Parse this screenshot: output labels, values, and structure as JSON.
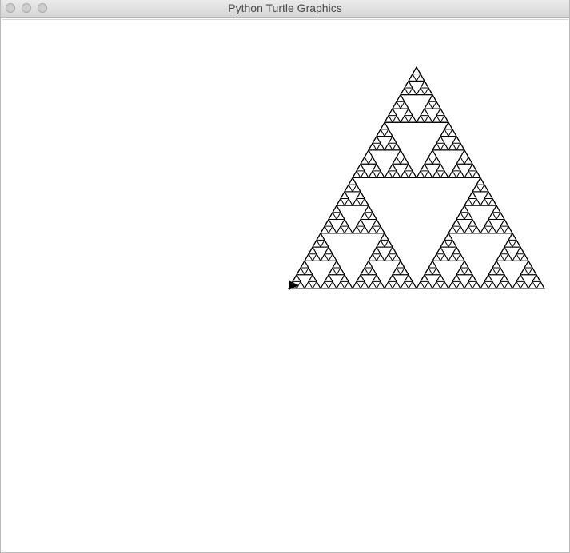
{
  "window": {
    "title": "Python Turtle Graphics"
  },
  "canvas": {
    "background_color": "#ffffff",
    "drawing": "sierpinski-triangle",
    "line_color": "#000000",
    "turtle_color": "#000000"
  }
}
